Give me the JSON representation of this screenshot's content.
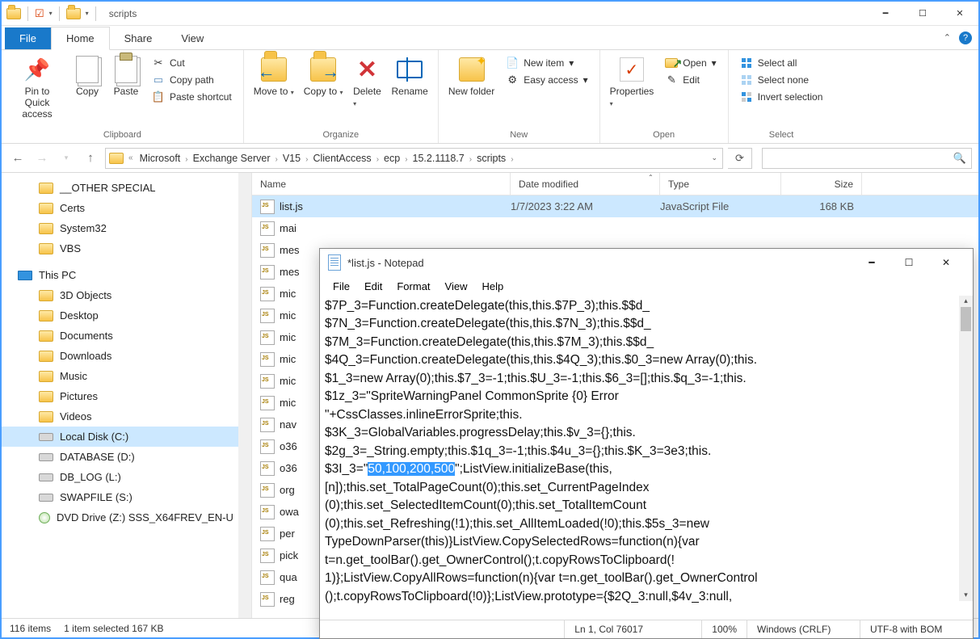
{
  "window": {
    "title": "scripts"
  },
  "tabs": {
    "file": "File",
    "home": "Home",
    "share": "Share",
    "view": "View"
  },
  "ribbon": {
    "clipboard": {
      "label": "Clipboard",
      "pin": "Pin to Quick access",
      "copy": "Copy",
      "paste": "Paste",
      "cut": "Cut",
      "copypath": "Copy path",
      "pasteshortcut": "Paste shortcut"
    },
    "organize": {
      "label": "Organize",
      "moveto": "Move to",
      "copyto": "Copy to",
      "delete": "Delete",
      "rename": "Rename"
    },
    "new": {
      "label": "New",
      "newfolder": "New folder",
      "newitem": "New item",
      "easyaccess": "Easy access"
    },
    "open": {
      "label": "Open",
      "properties": "Properties",
      "open": "Open",
      "edit": "Edit"
    },
    "select": {
      "label": "Select",
      "selectall": "Select all",
      "selectnone": "Select none",
      "invert": "Invert selection"
    }
  },
  "breadcrumb": {
    "prefix": "«",
    "items": [
      "Microsoft",
      "Exchange Server",
      "V15",
      "ClientAccess",
      "ecp",
      "15.2.1118.7",
      "scripts"
    ]
  },
  "tree": {
    "top": [
      "__OTHER SPECIAL",
      "Certs",
      "System32",
      "VBS"
    ],
    "pc": "This PC",
    "pc_items": [
      "3D Objects",
      "Desktop",
      "Documents",
      "Downloads",
      "Music",
      "Pictures",
      "Videos",
      "Local Disk (C:)",
      "DATABASE (D:)",
      "DB_LOG (L:)",
      "SWAPFILE (S:)",
      "DVD Drive (Z:) SSS_X64FREV_EN-U"
    ]
  },
  "columns": {
    "name": "Name",
    "date": "Date modified",
    "type": "Type",
    "size": "Size"
  },
  "files": {
    "selected": {
      "name": "list.js",
      "date": "1/7/2023 3:22 AM",
      "type": "JavaScript File",
      "size": "168 KB"
    },
    "partial": [
      "mai",
      "mes",
      "mes",
      "mic",
      "mic",
      "mic",
      "mic",
      "mic",
      "mic",
      "nav",
      "o36",
      "o36",
      "org",
      "owa",
      "per",
      "pick",
      "qua",
      "reg"
    ]
  },
  "status": {
    "count": "116 items",
    "selected": "1 item selected  167 KB"
  },
  "notepad": {
    "title": "*list.js - Notepad",
    "menu": [
      "File",
      "Edit",
      "Format",
      "View",
      "Help"
    ],
    "pre": "$7P_3=Function.createDelegate(this,this.$7P_3);this.$$d_\n$7N_3=Function.createDelegate(this,this.$7N_3);this.$$d_\n$7M_3=Function.createDelegate(this,this.$7M_3);this.$$d_\n$4Q_3=Function.createDelegate(this,this.$4Q_3);this.$0_3=new Array(0);this.\n$1_3=new Array(0);this.$7_3=-1;this.$U_3=-1;this.$6_3=[];this.$q_3=-1;this.\n$1z_3=\"SpriteWarningPanel CommonSprite {0} Error \n\"+CssClasses.inlineErrorSprite;this.\n$3K_3=GlobalVariables.progressDelay;this.$v_3={};this.\n$2g_3=_String.empty;this.$1q_3=-1;this.$4u_3={};this.$K_3=3e3;this.\n$3I_3=\"",
    "sel": "50,100,200,500",
    "post": "\";ListView.initializeBase(this,\n[n]);this.set_TotalPageCount(0);this.set_CurrentPageIndex\n(0);this.set_SelectedItemCount(0);this.set_TotalItemCount\n(0);this.set_Refreshing(!1);this.set_AllItemLoaded(!0);this.$5s_3=new \nTypeDownParser(this)}ListView.CopySelectedRows=function(n){var \nt=n.get_toolBar().get_OwnerControl();t.copyRowsToClipboard(!\n1)};ListView.CopyAllRows=function(n){var t=n.get_toolBar().get_OwnerControl\n();t.copyRowsToClipboard(!0)};ListView.prototype={$2Q_3:null,$4v_3:null,",
    "status": {
      "pos": "Ln 1, Col 76017",
      "zoom": "100%",
      "eol": "Windows (CRLF)",
      "enc": "UTF-8 with BOM"
    }
  }
}
